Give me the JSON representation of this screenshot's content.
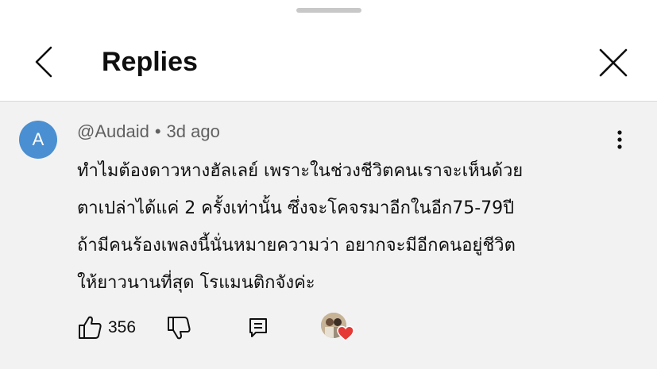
{
  "header": {
    "title": "Replies"
  },
  "comment": {
    "avatar_letter": "A",
    "avatar_color": "#4a8fd1",
    "author": "@Audaid",
    "separator": "•",
    "time": "3d ago",
    "lines": [
      "ทำไมต้องดาวหางฮัลเลย์ เพราะในช่วงชีวิตคนเราจะเห็นด้วย",
      "ตาเปล่าได้แค่ 2 ครั้งเท่านั้น ซึ่งจะโคจรมาอีกในอีก75-79ปี",
      "ถ้ามีคนร้องเพลงนี้นั่นหมายความว่า อยากจะมีอีกคนอยู่ชีวิต",
      "ให้ยาวนานที่สุด โรแมนติกจังค่ะ"
    ],
    "likes": "356",
    "heart_color": "#e53935"
  },
  "icons": {
    "back": "chevron-left-icon",
    "close": "close-icon",
    "more": "kebab-menu-icon",
    "like": "thumbs-up-icon",
    "dislike": "thumbs-down-icon",
    "reply": "reply-comment-icon",
    "creator_heart": "creator-heart-icon"
  }
}
